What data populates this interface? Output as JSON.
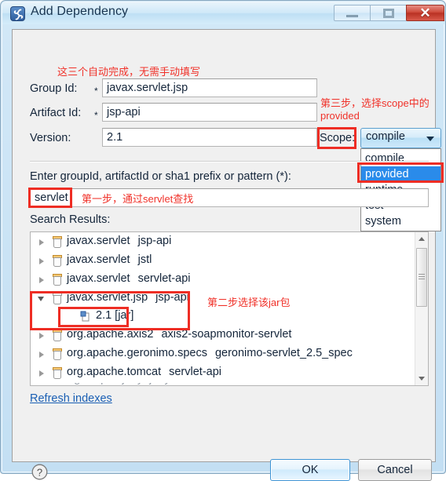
{
  "window": {
    "title": "Add Dependency",
    "app_icon": "maven-icon",
    "controls": {
      "minimize": "minimize-button",
      "maximize": "maximize-button",
      "close_glyph": "✕"
    }
  },
  "form": {
    "group_id": {
      "label": "Group Id:",
      "required_marker": "*",
      "value": "javax.servlet.jsp"
    },
    "artifact_id": {
      "label": "Artifact Id:",
      "required_marker": "*",
      "value": "jsp-api"
    },
    "version": {
      "label": "Version:",
      "value": "2.1"
    },
    "scope": {
      "label": "Scope:",
      "selected": "compile",
      "options": [
        "compile",
        "provided",
        "runtime",
        "test",
        "system"
      ],
      "highlighted": "provided",
      "highlight_color": "#2a8bea"
    }
  },
  "search": {
    "hint_label": "Enter groupId, artifactId or sha1 prefix or pattern (*):",
    "value": "servlet",
    "results_label": "Search Results:"
  },
  "results": [
    {
      "group": "javax.servlet",
      "artifact": "jsp-api",
      "expanded": false
    },
    {
      "group": "javax.servlet",
      "artifact": "jstl",
      "expanded": false
    },
    {
      "group": "javax.servlet",
      "artifact": "servlet-api",
      "expanded": false
    },
    {
      "group": "javax.servlet.jsp",
      "artifact": "jsp-api",
      "expanded": true
    },
    {
      "group": "org.apache.axis2",
      "artifact": "axis2-soapmonitor-servlet",
      "expanded": false
    },
    {
      "group": "org.apache.geronimo.specs",
      "artifact": "geronimo-servlet_2.5_spec",
      "expanded": false
    },
    {
      "group": "org.apache.tomcat",
      "artifact": "servlet-api",
      "expanded": false
    }
  ],
  "results_child": {
    "label": "2.1 [jar]",
    "parent_index": 3
  },
  "links": {
    "refresh_indexes": "Refresh indexes"
  },
  "buttons": {
    "ok": "OK",
    "cancel": "Cancel",
    "help": "?"
  },
  "annotations": {
    "color": "#ee2d24",
    "top_note": "这三个自动完成，无需手动填写",
    "scope_note": "第三步，选择scope中的 provided",
    "step1_note": "第一步，通过servlet查找",
    "step2_note": "第二步选择该jar包"
  }
}
